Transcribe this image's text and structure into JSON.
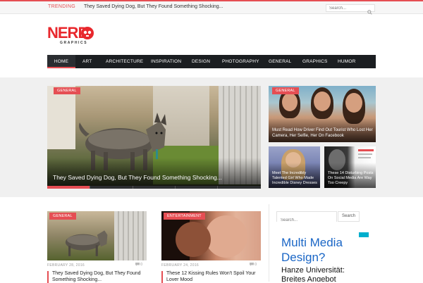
{
  "topbar": {
    "trending_label": "TRENDING",
    "trending_headline": "They Saved Dying Dog, But They Found Something Shocking...",
    "search_placeholder": "Search..."
  },
  "logo": {
    "main": "NERD",
    "sub": "GRAPHICS"
  },
  "nav": {
    "items": [
      {
        "label": "HOME",
        "active": true
      },
      {
        "label": "ART"
      },
      {
        "label": "ARCHITECTURE"
      },
      {
        "label": "INSPIRATION"
      },
      {
        "label": "DESIGN"
      },
      {
        "label": "PHOTOGRAPHY"
      },
      {
        "label": "GENERAL"
      },
      {
        "label": "GRAPHICS"
      },
      {
        "label": "HUMOR"
      }
    ]
  },
  "featured": {
    "category": "GENERAL",
    "title": "They Saved Dying Dog, But They Found Something Shocking..."
  },
  "grid": {
    "top_right": {
      "category": "GENERAL",
      "title": "Must Read How Driver Find Out Tourist Who Lost Her Camera, Her Selfie, Her On Facebook"
    },
    "small_a": {
      "title": "Meet The Incredibly Talented Girl Who Made Incredible Disney Dresses"
    },
    "small_b": {
      "title": "These 14 Disturbing Posts On Social Media Are Way Too Creepy"
    }
  },
  "posts": [
    {
      "category": "GENERAL",
      "date": "FEBRUARY 28, 2016",
      "comments": "0",
      "title": "They Saved Dying Dog, But They Found Something Shocking..."
    },
    {
      "category": "ENTERTAINMENT",
      "date": "FEBRUARY 24, 2016",
      "comments": "0",
      "title": "These 12 Kissing Rules Won't Spoil Your Lover Mood"
    }
  ],
  "sidebar": {
    "search_placeholder": "Search...",
    "search_button": "Search",
    "ad_title": "Multi Media Design?",
    "ad_sub": "Hanze Universität: Breites Angebot"
  },
  "colors": {
    "accent": "#e54e53",
    "nav_bg": "#1b1e21",
    "ad_link": "#1a66c6"
  }
}
